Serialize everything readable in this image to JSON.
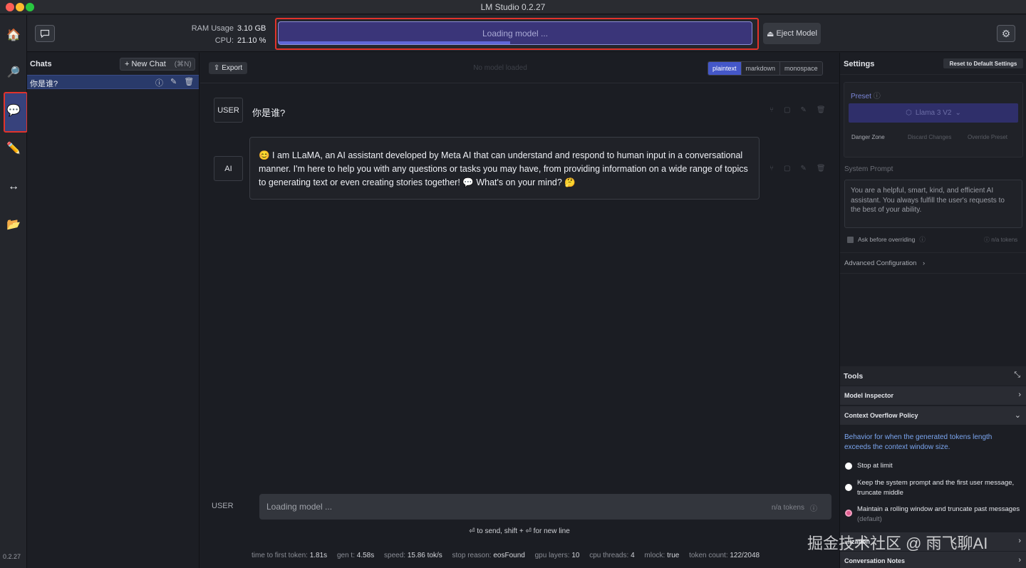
{
  "window": {
    "title": "LM Studio 0.2.27"
  },
  "toolbar": {
    "ram_label": "RAM Usage",
    "ram_value": "3.10 GB",
    "cpu_label": "CPU:",
    "cpu_value": "21.10 %",
    "loading_text": "Loading model ...",
    "loading_progress": 0.49,
    "eject_label": "Eject Model"
  },
  "rail": {
    "items": [
      "home-icon",
      "search-icon",
      "chat-icon",
      "pencil-icon",
      "arrows-icon",
      "folder-icon"
    ],
    "active": "chat-icon",
    "version": "0.2.27"
  },
  "chats": {
    "title": "Chats",
    "new_chat_label": "+ New Chat",
    "new_chat_shortcut": "(⌘N)",
    "items": [
      {
        "label": "你是谁?"
      }
    ]
  },
  "main": {
    "export_label": "Export",
    "status": "No model loaded",
    "formats": [
      "plaintext",
      "markdown",
      "monospace"
    ],
    "active_format": "plaintext",
    "messages": [
      {
        "role": "USER",
        "text": "你是谁?"
      },
      {
        "role": "AI",
        "text": "😊 I am LLaMA, an AI assistant developed by Meta AI that can understand and respond to human input in a conversational manner. I'm here to help you with any questions or tasks you may have, from providing information on a wide range of topics to generating text or even creating stories together! 💬 What's on your mind? 🤔"
      }
    ],
    "input_role": "USER",
    "input_placeholder": "Loading model ...",
    "input_tokens": "n/a tokens",
    "hint": "⏎ to send, shift + ⏎ for new line",
    "metrics": [
      {
        "label": "time to first token:",
        "value": "1.81s"
      },
      {
        "label": "gen t:",
        "value": "4.58s"
      },
      {
        "label": "speed:",
        "value": "15.86 tok/s"
      },
      {
        "label": "stop reason:",
        "value": "eosFound"
      },
      {
        "label": "gpu layers:",
        "value": "10"
      },
      {
        "label": "cpu threads:",
        "value": "4"
      },
      {
        "label": "mlock:",
        "value": "true"
      },
      {
        "label": "token count:",
        "value": "122/2048"
      }
    ]
  },
  "settings": {
    "title": "Settings",
    "reset_label": "Reset to Default Settings",
    "preset_label": "Preset",
    "preset_value": "Llama 3 V2",
    "danger_zone": "Danger Zone",
    "discard_label": "Discard Changes",
    "override_label": "Override Preset",
    "system_prompt_label": "System Prompt",
    "system_prompt": "You are a helpful, smart, kind, and efficient AI assistant. You always fulfill the user's requests to the best of your ability.",
    "ask_label": "Ask before overriding",
    "ask_tokens": "n/a tokens",
    "advanced_label": "Advanced Configuration"
  },
  "tools": {
    "title": "Tools",
    "model_inspector": "Model Inspector",
    "context_policy": "Context Overflow Policy",
    "policy_desc": "Behavior for when the generated tokens length exceeds the context window size.",
    "options": [
      {
        "label": "Stop at limit",
        "selected": false
      },
      {
        "label": "Keep the system prompt and the first user message, truncate middle",
        "selected": false
      },
      {
        "label": "Maintain a rolling window and truncate past messages",
        "suffix": "(default)",
        "selected": true
      }
    ],
    "partial_row": "...ization",
    "conversation_notes": "Conversation Notes"
  },
  "watermark": "掘金技术社区 @ 雨飞聊AI",
  "colors": {
    "accent": "#4457c8",
    "highlight_border": "#e2332b",
    "loader_bg": "#3a3579"
  }
}
